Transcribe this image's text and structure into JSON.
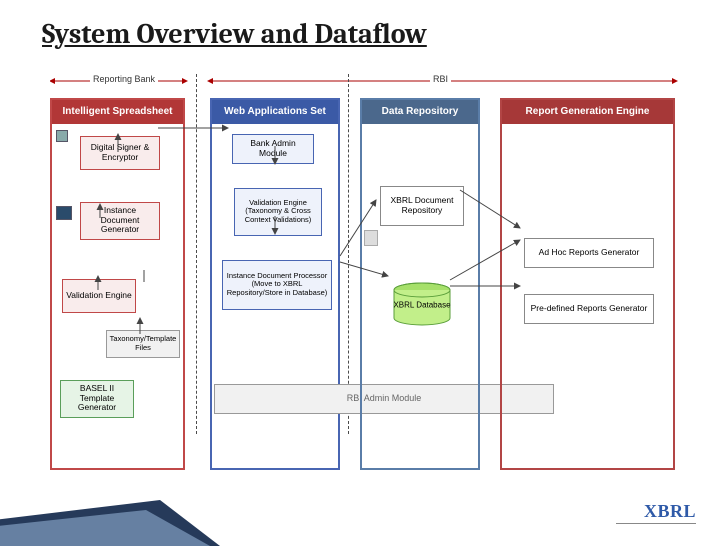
{
  "title": "System Overview and Dataflow",
  "lanes": {
    "reporting": "Reporting Bank",
    "rbi": "RBI"
  },
  "columns": {
    "c1": "Intelligent Spreadsheet",
    "c2": "Web Applications Set",
    "c3": "Data Repository",
    "c4": "Report Generation Engine"
  },
  "boxes": {
    "signer": "Digital Signer & Encryptor",
    "instgen": "Instance Document Generator",
    "valeng": "Validation Engine",
    "taxfiles": "Taxonomy/Template Files",
    "basel": "BASEL II Template Generator",
    "bankadmin": "Bank Admin Module",
    "valeng2": "Validation Engine (Taxonomy & Cross Context Validations)",
    "idp": "Instance Document Processor (Move to XBRL Repository/Store in Database)",
    "rbiadmin": "RBI Admin Module",
    "xbrlrepo": "XBRL Document Repository",
    "xbrldb": "XBRL Database",
    "adhoc": "Ad Hoc Reports Generator",
    "predef": "Pre-defined Reports Generator"
  },
  "logo": {
    "main": "XBRL",
    "sub": ""
  }
}
